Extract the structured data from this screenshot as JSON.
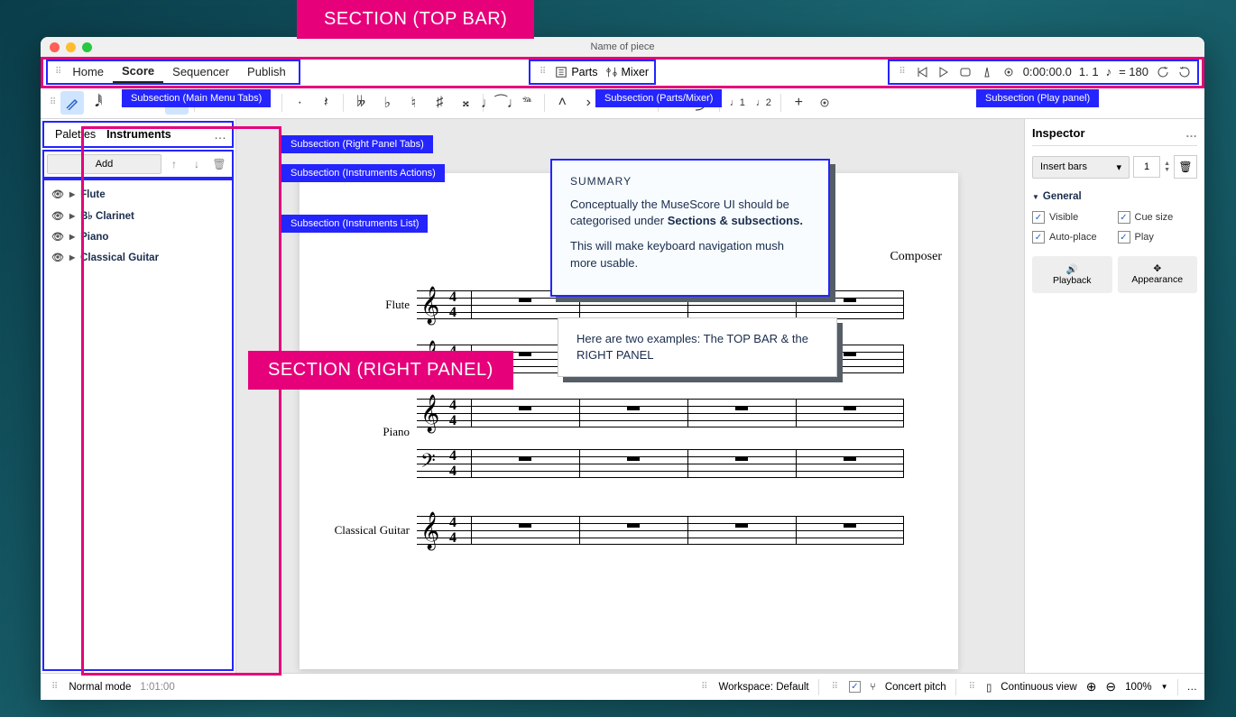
{
  "window_title": "Name of piece",
  "annotations": {
    "section_top": "SECTION (TOP BAR)",
    "section_right": "SECTION (RIGHT PANEL)",
    "sub_main": "Subsection (Main Menu Tabs)",
    "sub_parts": "Subsection (Parts/Mixer)",
    "sub_play": "Subsection (Play panel)",
    "sub_rptabs": "Subsection (Right Panel Tabs)",
    "sub_actions": "Subsection (Instruments Actions)",
    "sub_list": "Subsection (Instruments List)",
    "summary_title": "SUMMARY",
    "summary_p1a": "Conceptually the MuseScore UI should be categorised under ",
    "summary_p1b": "Sections & subsections.",
    "summary_p2": "This will make keyboard navigation mush more usable.",
    "example": "Here are two examples: The TOP BAR & the RIGHT PANEL"
  },
  "topbar": {
    "tabs": [
      "Home",
      "Score",
      "Sequencer",
      "Publish"
    ],
    "parts": "Parts",
    "mixer": "Mixer",
    "time": "0:00:00.0",
    "beat": "1.  1",
    "tempo_eq": "= 180"
  },
  "left": {
    "tab_palettes": "Palettes",
    "tab_instruments": "Instruments",
    "add": "Add",
    "instruments": [
      "Flute",
      "B♭ Clarinet",
      "Piano",
      "Classical Guitar"
    ]
  },
  "score": {
    "composer": "Composer",
    "staves": [
      "Flute",
      "",
      "Piano",
      "",
      "Classical Guitar"
    ]
  },
  "inspector": {
    "title": "Inspector",
    "insert": "Insert bars",
    "count": "1",
    "general": "General",
    "visible": "Visible",
    "cue": "Cue size",
    "auto": "Auto-place",
    "play": "Play",
    "playback": "Playback",
    "appearance": "Appearance"
  },
  "bottom": {
    "mode": "Normal mode",
    "duration": "1:01:00",
    "workspace_label": "Workspace:",
    "workspace": "Default",
    "concert": "Concert pitch",
    "view": "Continuous view",
    "zoom": "100%"
  }
}
